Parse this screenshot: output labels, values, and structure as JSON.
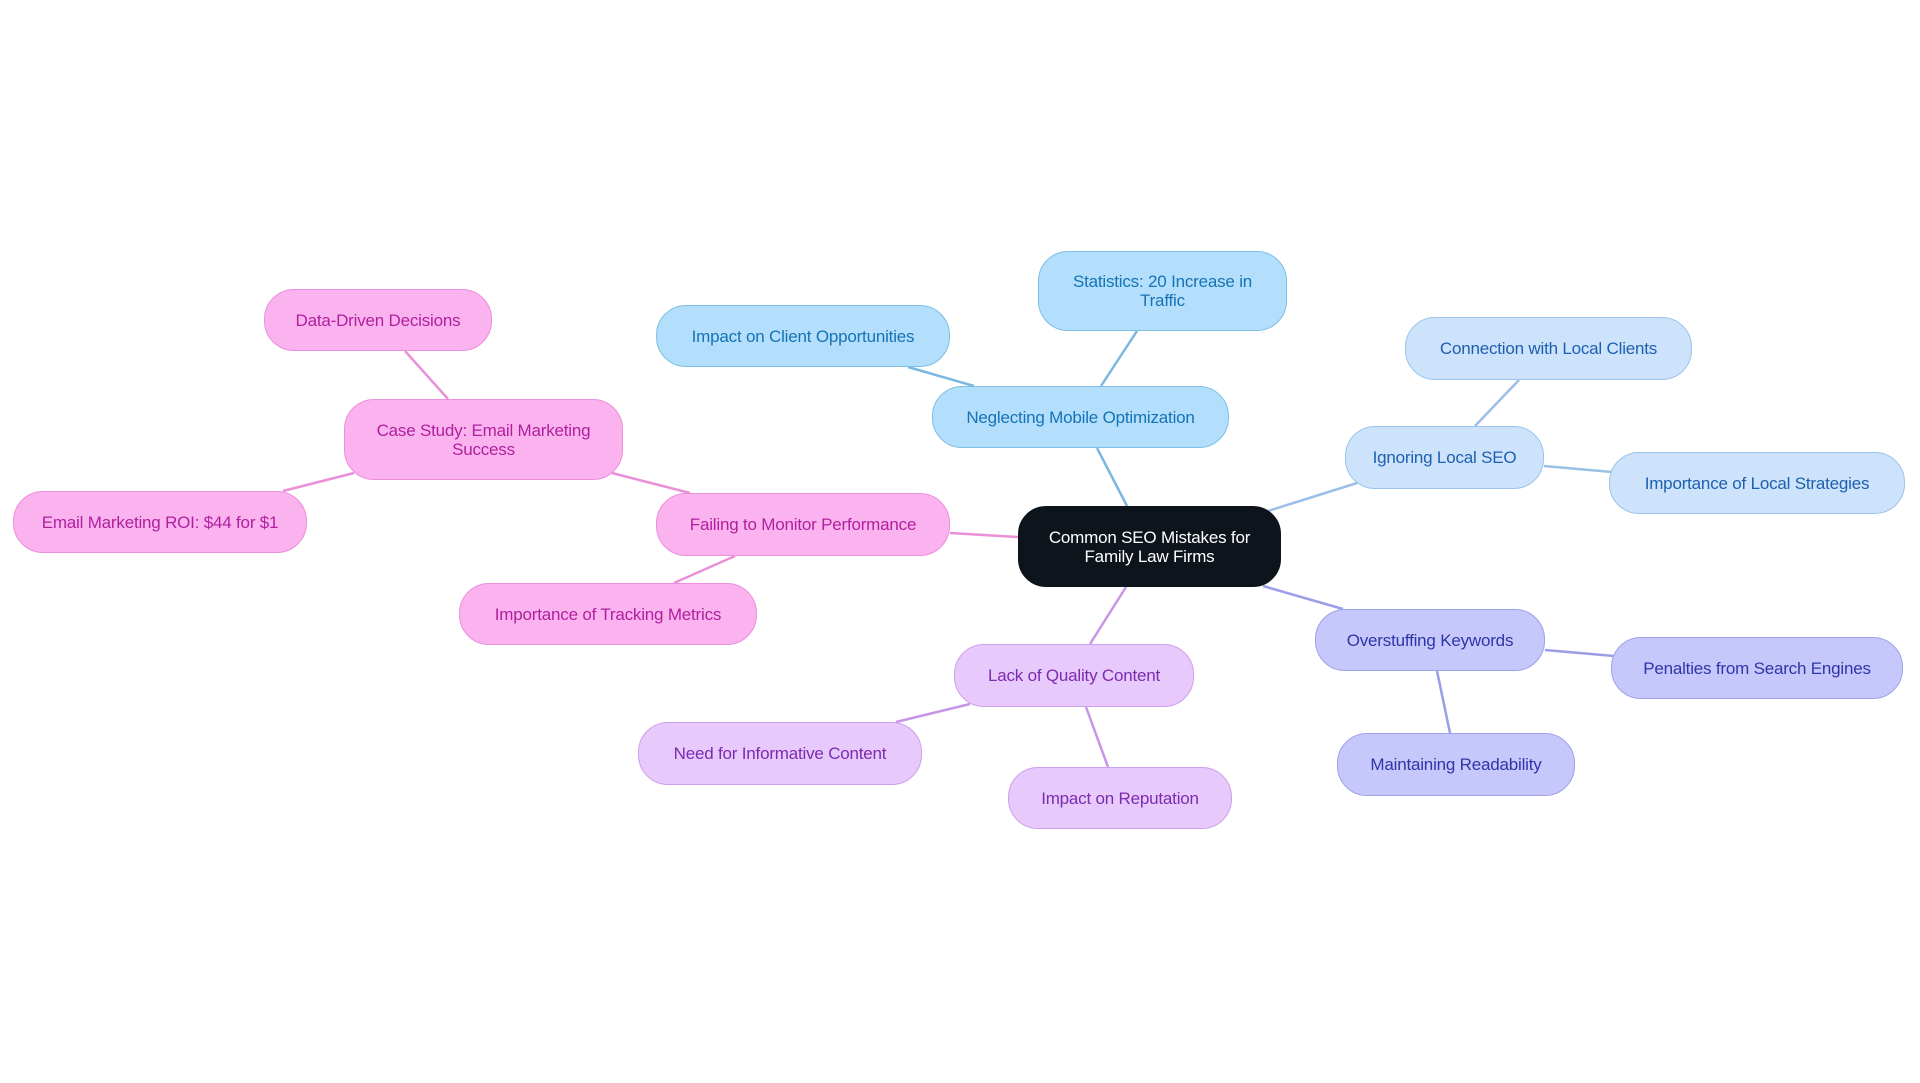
{
  "diagram": {
    "type": "mindmap",
    "root": {
      "id": "root",
      "label": "Common SEO Mistakes for Family Law Firms"
    },
    "branches": [
      {
        "id": "mobile",
        "label": "Neglecting Mobile Optimization",
        "color_fill": "#b3dffc",
        "color_border": "#7fbfe6",
        "color_text": "#1673b6",
        "color_edge": "#7ab8e0",
        "children": [
          {
            "id": "mobile-client",
            "label": "Impact on Client Opportunities"
          },
          {
            "id": "mobile-stats",
            "label": "Statistics: 20 Increase in Traffic"
          }
        ]
      },
      {
        "id": "local",
        "label": "Ignoring Local SEO",
        "color_fill": "#cce3fb",
        "color_border": "#9cc3ea",
        "color_text": "#1e5fb0",
        "color_edge": "#9bbfe6",
        "children": [
          {
            "id": "local-connection",
            "label": "Connection with Local Clients"
          },
          {
            "id": "local-importance",
            "label": "Importance of Local Strategies"
          }
        ]
      },
      {
        "id": "keywords",
        "label": "Overstuffing Keywords",
        "color_fill": "#c6c8fb",
        "color_border": "#9ea2ea",
        "color_text": "#2f35a8",
        "color_edge": "#9a9ee6",
        "children": [
          {
            "id": "keywords-penalties",
            "label": "Penalties from Search Engines"
          },
          {
            "id": "keywords-readability",
            "label": "Maintaining Readability"
          }
        ]
      },
      {
        "id": "content",
        "label": "Lack of Quality Content",
        "color_fill": "#e8c9fb",
        "color_border": "#cfa0ec",
        "color_text": "#7b2bb0",
        "color_edge": "#c896e8",
        "children": [
          {
            "id": "content-informative",
            "label": "Need for Informative Content"
          },
          {
            "id": "content-reputation",
            "label": "Impact on Reputation"
          }
        ]
      },
      {
        "id": "monitor",
        "label": "Failing to Monitor Performance",
        "color_fill": "#fbb3f0",
        "color_border": "#ec8fdc",
        "color_text": "#b01f9e",
        "color_edge": "#ea8fd8",
        "children": [
          {
            "id": "monitor-tracking",
            "label": "Importance of Tracking Metrics"
          },
          {
            "id": "monitor-case",
            "label": "Case Study: Email Marketing Success",
            "children": [
              {
                "id": "case-data",
                "label": "Data-Driven Decisions"
              },
              {
                "id": "case-roi",
                "label": "Email Marketing ROI: $44 for $1"
              }
            ]
          }
        ]
      }
    ],
    "root_style": {
      "color_fill": "#0d141b",
      "color_text": "#ffffff"
    }
  }
}
